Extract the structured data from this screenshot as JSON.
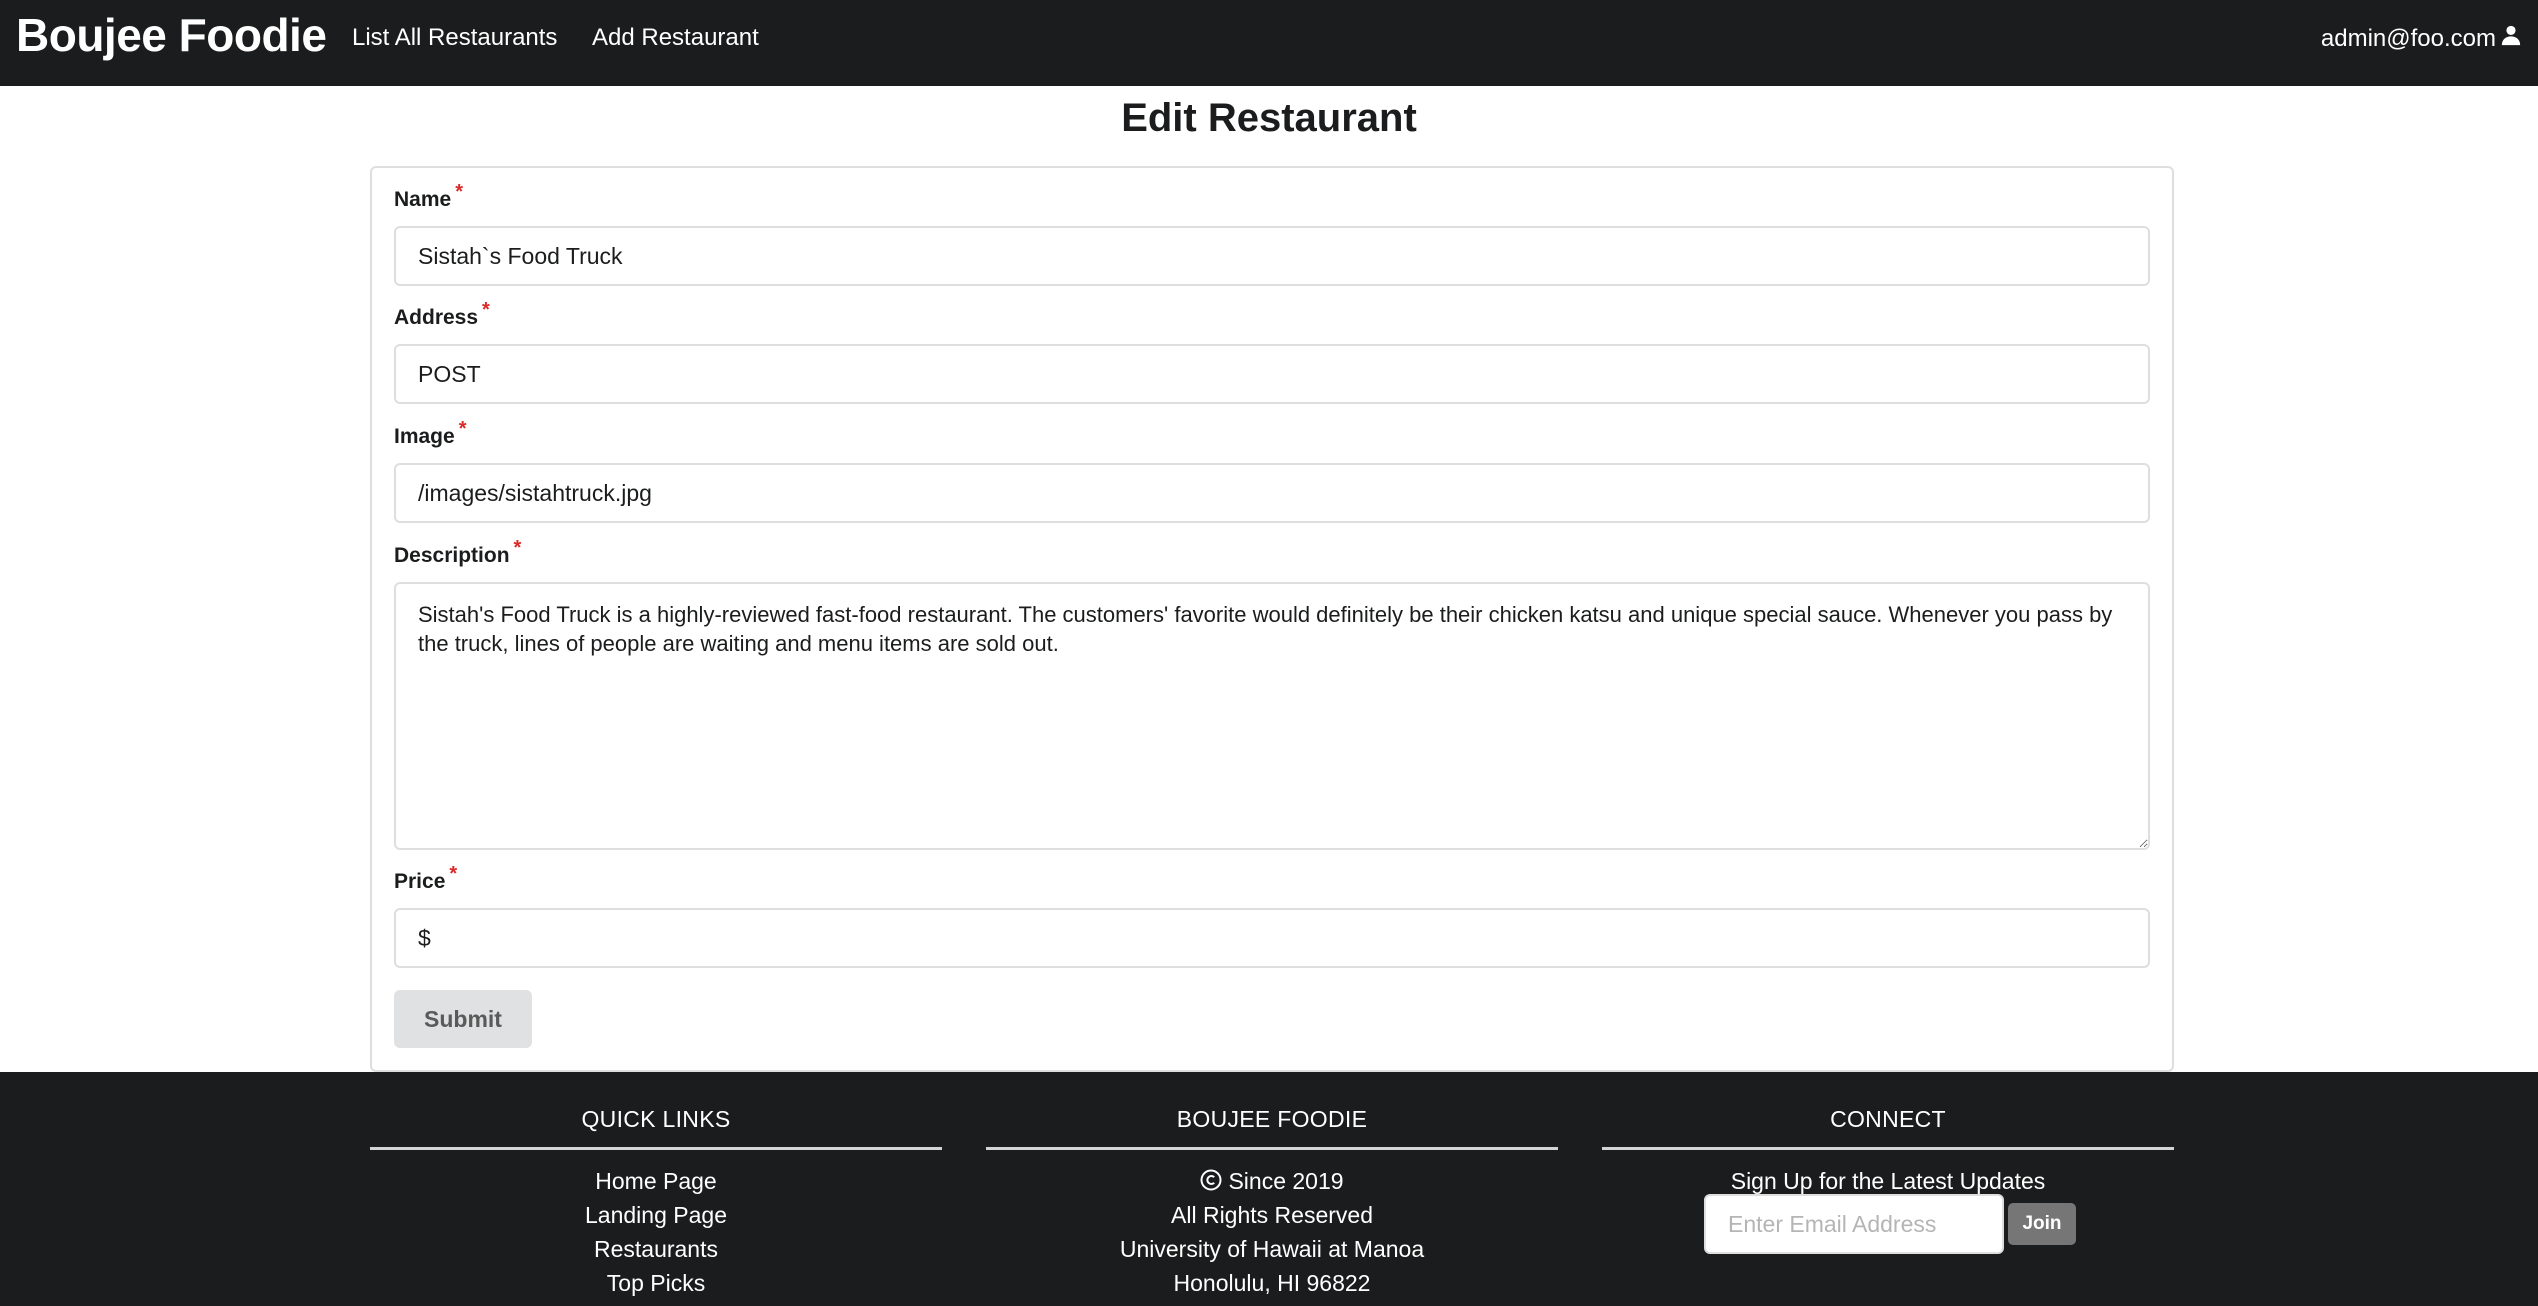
{
  "navbar": {
    "brand": "Boujee Foodie",
    "links": [
      "List All Restaurants",
      "Add Restaurant"
    ],
    "user_email": "admin@foo.com",
    "user_icon": "user-icon"
  },
  "page": {
    "title": "Edit Restaurant"
  },
  "form": {
    "required_marker": "*",
    "fields": {
      "name": {
        "label": "Name",
        "value": "Sistah`s Food Truck"
      },
      "address": {
        "label": "Address",
        "value": "POST"
      },
      "image": {
        "label": "Image",
        "value": "/images/sistahtruck.jpg"
      },
      "description": {
        "label": "Description",
        "value": "Sistah's Food Truck is a highly-reviewed fast-food restaurant. The customers' favorite would definitely be their chicken katsu and unique special sauce. Whenever you pass by the truck, lines of people are waiting and menu items are sold out."
      },
      "price": {
        "label": "Price",
        "value": "$"
      }
    },
    "submit_label": "Submit"
  },
  "footer": {
    "quick_links": {
      "heading": "QUICK LINKS",
      "items": [
        "Home Page",
        "Landing Page",
        "Restaurants",
        "Top Picks"
      ]
    },
    "about": {
      "heading": "BOUJEE FOODIE",
      "since": "Since 2019",
      "copyright_icon": "copyright-icon",
      "lines": [
        "All Rights Reserved",
        "University of Hawaii at Manoa",
        "Honolulu, HI 96822"
      ]
    },
    "connect": {
      "heading": "CONNECT",
      "signup_text": "Sign Up for the Latest Updates",
      "email_placeholder": "Enter Email Address",
      "join_label": "Join"
    }
  },
  "colors": {
    "navbar_bg": "#1b1c1d",
    "footer_bg": "#1b1c1d",
    "required": "#db2828",
    "submit_bg": "#e0e1e2",
    "join_bg": "#767676"
  }
}
